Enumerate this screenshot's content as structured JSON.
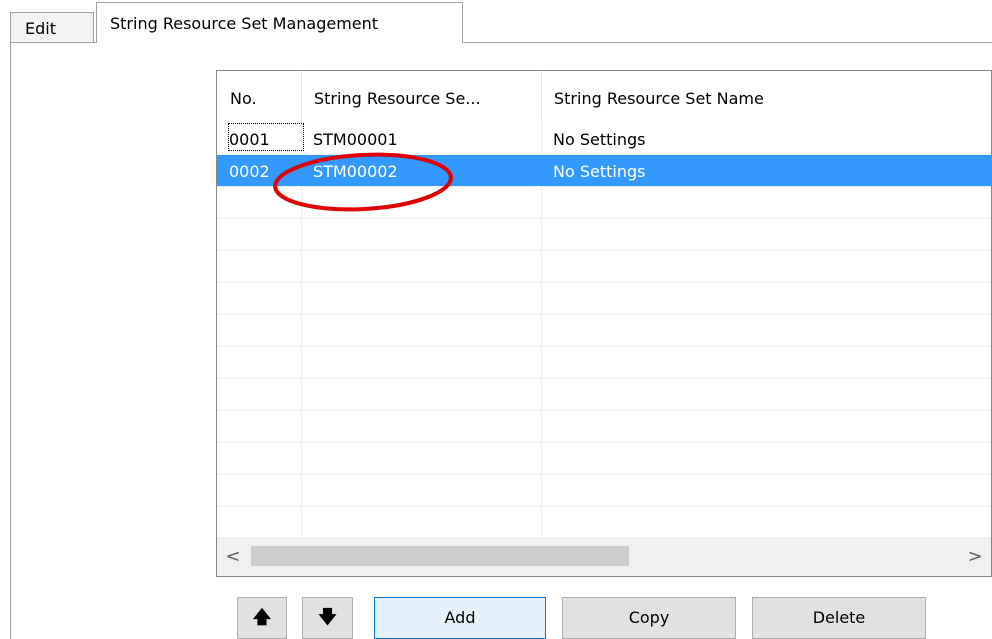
{
  "tabs": [
    {
      "label": "Edit",
      "active": false
    },
    {
      "label": "String Resource Set Management",
      "active": true
    }
  ],
  "list": {
    "columns": [
      "No.",
      "String Resource Se...",
      "String Resource Set Name"
    ],
    "rows": [
      {
        "no": "0001",
        "id": "STM00001",
        "name": "No Settings",
        "selected": false
      },
      {
        "no": "0002",
        "id": "STM00002",
        "name": "No Settings",
        "selected": true
      }
    ]
  },
  "scrollbar": {
    "left_icon": "chevron-left-icon",
    "right_icon": "chevron-right-icon",
    "left_glyph": "<",
    "right_glyph": ">"
  },
  "buttons": {
    "up_icon": "arrow-up-icon",
    "up_glyph": "🡅",
    "down_icon": "arrow-down-icon",
    "down_glyph": "🡇",
    "add": "Add",
    "copy": "Copy",
    "delete": "Delete"
  },
  "colors": {
    "selection": "#3399ff",
    "annotation": "#e00000",
    "default_button_border": "#0078d7"
  }
}
